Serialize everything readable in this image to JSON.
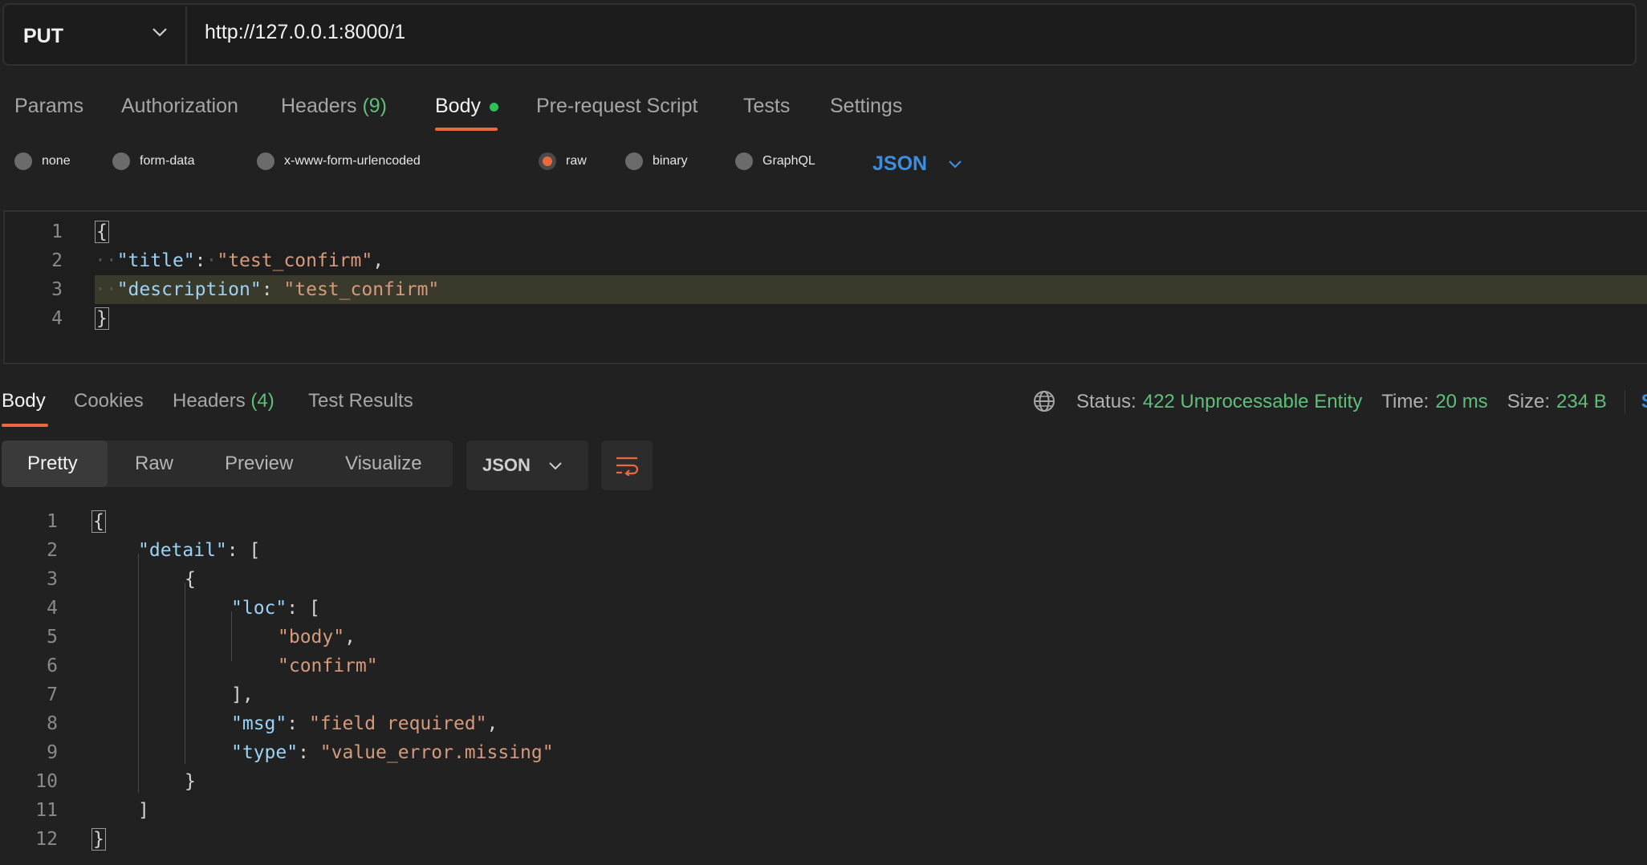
{
  "request": {
    "method": "PUT",
    "url": "http://127.0.0.1:8000/1"
  },
  "request_tabs": {
    "params": "Params",
    "authorization": "Authorization",
    "headers": "Headers",
    "headers_count": "(9)",
    "body": "Body",
    "pre_request": "Pre-request Script",
    "tests": "Tests",
    "settings": "Settings"
  },
  "body_types": {
    "none": "none",
    "form_data": "form-data",
    "urlencoded": "x-www-form-urlencoded",
    "raw": "raw",
    "binary": "binary",
    "graphql": "GraphQL",
    "selected": "raw",
    "language": "JSON"
  },
  "request_body": {
    "line_numbers": [
      "1",
      "2",
      "3",
      "4"
    ],
    "open": "{",
    "title_key": "\"title\"",
    "title_value": "\"test_confirm\"",
    "description_key": "\"description\"",
    "description_value": "\"test_confirm\"",
    "close": "}"
  },
  "response_tabs": {
    "body": "Body",
    "cookies": "Cookies",
    "headers": "Headers",
    "headers_count": "(4)",
    "test_results": "Test Results"
  },
  "response_status": {
    "status_label": "Status:",
    "status_value": "422 Unprocessable Entity",
    "time_label": "Time:",
    "time_value": "20 ms",
    "size_label": "Size:",
    "size_value": "234 B",
    "save_partial": "S"
  },
  "response_view": {
    "pretty": "Pretty",
    "raw": "Raw",
    "preview": "Preview",
    "visualize": "Visualize",
    "format": "JSON"
  },
  "response_body": {
    "line_numbers": [
      "1",
      "2",
      "3",
      "4",
      "5",
      "6",
      "7",
      "8",
      "9",
      "10",
      "11",
      "12"
    ],
    "l1": "{",
    "detail_key": "\"detail\"",
    "l2_rest": ": [",
    "l3": "{",
    "loc_key": "\"loc\"",
    "l4_rest": ": [",
    "l5": "\"body\"",
    "l6": "\"confirm\"",
    "l7": "],",
    "msg_key": "\"msg\"",
    "msg_value": "\"field required\"",
    "type_key": "\"type\"",
    "type_value": "\"value_error.missing\"",
    "l10": "}",
    "l11": "]",
    "l12": "}"
  },
  "colors": {
    "accent": "#e86a3e",
    "success": "#5fbf7a",
    "link": "#3a8fe0",
    "json_key": "#9cd3f5",
    "json_string": "#d69a7c"
  }
}
